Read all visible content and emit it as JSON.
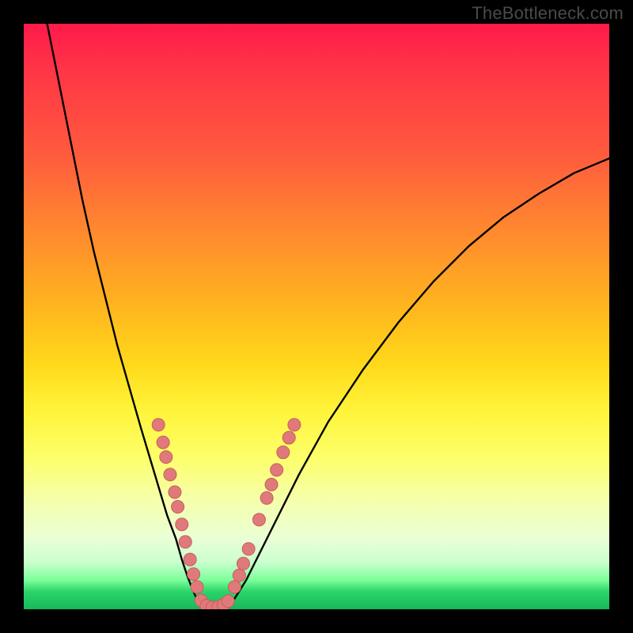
{
  "watermark": {
    "text": "TheBottleneck.com"
  },
  "colors": {
    "curve": "#000000",
    "dot_fill": "#e07a7a",
    "dot_stroke": "#c75d5d"
  },
  "chart_data": {
    "type": "line",
    "title": "",
    "xlabel": "",
    "ylabel": "",
    "xlim": [
      0,
      100
    ],
    "ylim": [
      0,
      100
    ],
    "grid": false,
    "legend": false,
    "series": [
      {
        "name": "left-branch",
        "x": [
          4,
          6,
          8,
          10,
          12,
          14,
          16,
          18,
          20,
          21.5,
          23,
          24.5,
          26,
          27,
          28,
          29,
          29.8,
          30.5
        ],
        "values": [
          100,
          90,
          80,
          70,
          61,
          53,
          45,
          38,
          31,
          26,
          21,
          16,
          12,
          8.5,
          5.5,
          3,
          1.2,
          0.2
        ]
      },
      {
        "name": "valley-floor",
        "x": [
          30.5,
          31.5,
          32.5,
          33.5,
          34.5
        ],
        "values": [
          0.2,
          0,
          0,
          0,
          0.2
        ]
      },
      {
        "name": "right-branch",
        "x": [
          34.5,
          36,
          38,
          40,
          43,
          47,
          52,
          58,
          64,
          70,
          76,
          82,
          88,
          94,
          100
        ],
        "values": [
          0.2,
          1.8,
          5,
          9,
          15,
          23,
          32,
          41,
          49,
          56,
          62,
          67,
          71,
          74.5,
          77
        ]
      }
    ],
    "scatter": [
      {
        "name": "dots-left-arm",
        "points": [
          {
            "x": 23.0,
            "y": 31.5
          },
          {
            "x": 23.8,
            "y": 28.5
          },
          {
            "x": 24.3,
            "y": 26.0
          },
          {
            "x": 25.0,
            "y": 23.0
          },
          {
            "x": 25.8,
            "y": 20.0
          },
          {
            "x": 26.3,
            "y": 17.5
          },
          {
            "x": 27.0,
            "y": 14.5
          },
          {
            "x": 27.6,
            "y": 11.5
          },
          {
            "x": 28.4,
            "y": 8.5
          },
          {
            "x": 29.0,
            "y": 6.0
          },
          {
            "x": 29.6,
            "y": 3.8
          }
        ]
      },
      {
        "name": "dots-valley",
        "points": [
          {
            "x": 30.3,
            "y": 1.5
          },
          {
            "x": 31.2,
            "y": 0.6
          },
          {
            "x": 32.2,
            "y": 0.3
          },
          {
            "x": 33.2,
            "y": 0.4
          },
          {
            "x": 34.1,
            "y": 0.8
          },
          {
            "x": 34.9,
            "y": 1.4
          }
        ]
      },
      {
        "name": "dots-right-arm",
        "points": [
          {
            "x": 36.0,
            "y": 3.8
          },
          {
            "x": 36.8,
            "y": 5.8
          },
          {
            "x": 37.5,
            "y": 7.8
          },
          {
            "x": 38.4,
            "y": 10.3
          },
          {
            "x": 40.2,
            "y": 15.3
          },
          {
            "x": 41.5,
            "y": 19.0
          },
          {
            "x": 42.3,
            "y": 21.3
          },
          {
            "x": 43.2,
            "y": 23.8
          },
          {
            "x": 44.3,
            "y": 26.8
          },
          {
            "x": 45.3,
            "y": 29.3
          },
          {
            "x": 46.2,
            "y": 31.5
          }
        ]
      }
    ]
  }
}
